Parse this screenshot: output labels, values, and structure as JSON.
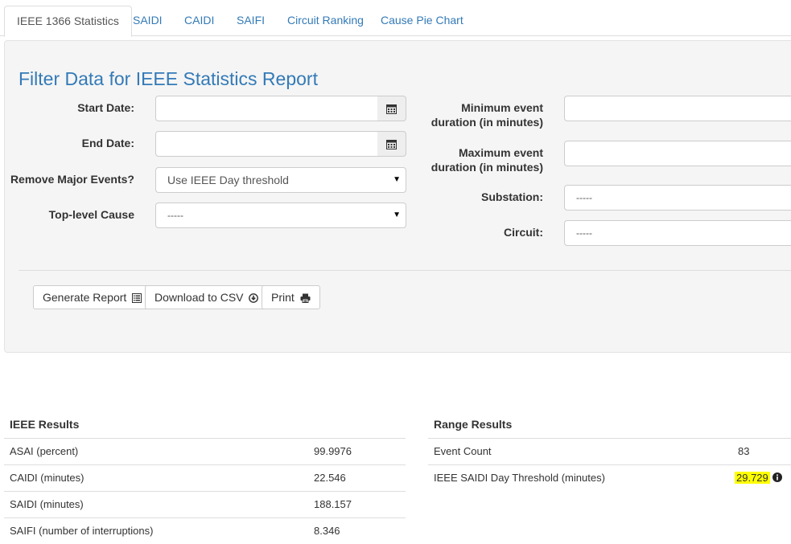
{
  "tabs": [
    {
      "label": "IEEE 1366 Statistics"
    },
    {
      "label": "SAIDI"
    },
    {
      "label": "CAIDI"
    },
    {
      "label": "SAIFI"
    },
    {
      "label": "Circuit Ranking"
    },
    {
      "label": "Cause Pie Chart"
    }
  ],
  "filter": {
    "title": "Filter Data for IEEE Statistics Report",
    "start_date_label": "Start Date:",
    "start_date_value": "",
    "end_date_label": "End Date:",
    "end_date_value": "",
    "remove_major_label": "Remove Major Events?",
    "remove_major_value": "Use IEEE Day threshold",
    "top_cause_label": "Top-level Cause",
    "top_cause_value": "-----",
    "min_duration_label": "Minimum event duration (in minutes)",
    "min_duration_value": "",
    "max_duration_label": "Maximum event duration (in minutes)",
    "max_duration_value": "",
    "substation_label": "Substation:",
    "substation_value": "-----",
    "circuit_label": "Circuit:",
    "circuit_value": "-----"
  },
  "buttons": {
    "generate": "Generate Report",
    "download": "Download to CSV",
    "print": "Print"
  },
  "ieee_results": {
    "heading": "IEEE Results",
    "rows": [
      {
        "name": "ASAI (percent)",
        "value": "99.9976"
      },
      {
        "name": "CAIDI (minutes)",
        "value": "22.546"
      },
      {
        "name": "SAIDI (minutes)",
        "value": "188.157"
      },
      {
        "name": "SAIFI (number of interruptions)",
        "value": "8.346"
      }
    ]
  },
  "range_results": {
    "heading": "Range Results",
    "rows": [
      {
        "name": "Event Count",
        "value": "83"
      },
      {
        "name": "IEEE SAIDI Day Threshold (minutes)",
        "value": "29.729"
      }
    ]
  },
  "colors": {
    "accent": "#337ab7",
    "highlight": "#ffff00"
  }
}
